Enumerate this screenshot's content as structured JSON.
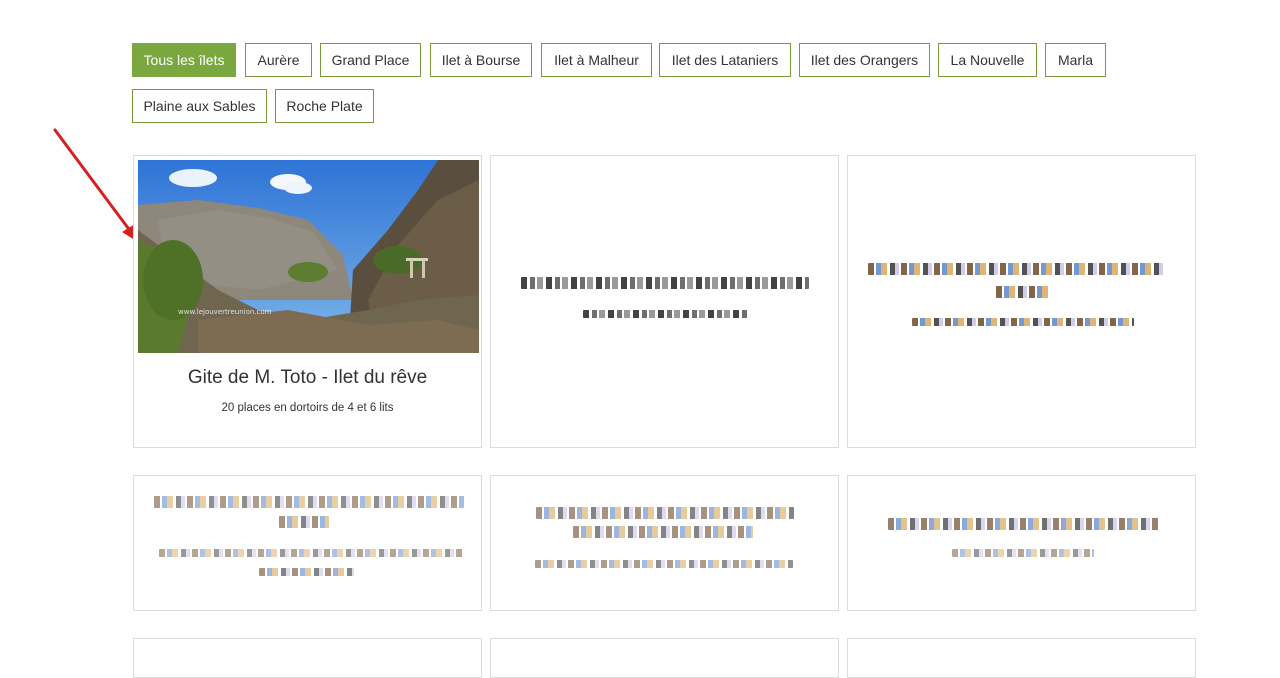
{
  "filters": {
    "all": "Tous les îlets",
    "f1": "Aurère",
    "f2": "Grand Place",
    "f3": "Ilet à Bourse",
    "f4": "Ilet à Malheur",
    "f5": "Ilet des Lataniers",
    "f6": "Ilet des Orangers",
    "f7": "La Nouvelle",
    "f8": "Marla",
    "f9": "Plaine aux Sables",
    "f10": "Roche Plate"
  },
  "cards": {
    "first": {
      "title": "Gite de M. Toto - Ilet du rêve",
      "subtitle": "20 places en dortoirs de 4 et 6 lits",
      "watermark": "www.lejouvertreunion.com"
    }
  },
  "colors": {
    "accent": "#7aa83f",
    "border_accent": "#7a9a3a",
    "arrow": "#d42020"
  },
  "icons": {
    "annotation": "red-arrow"
  }
}
